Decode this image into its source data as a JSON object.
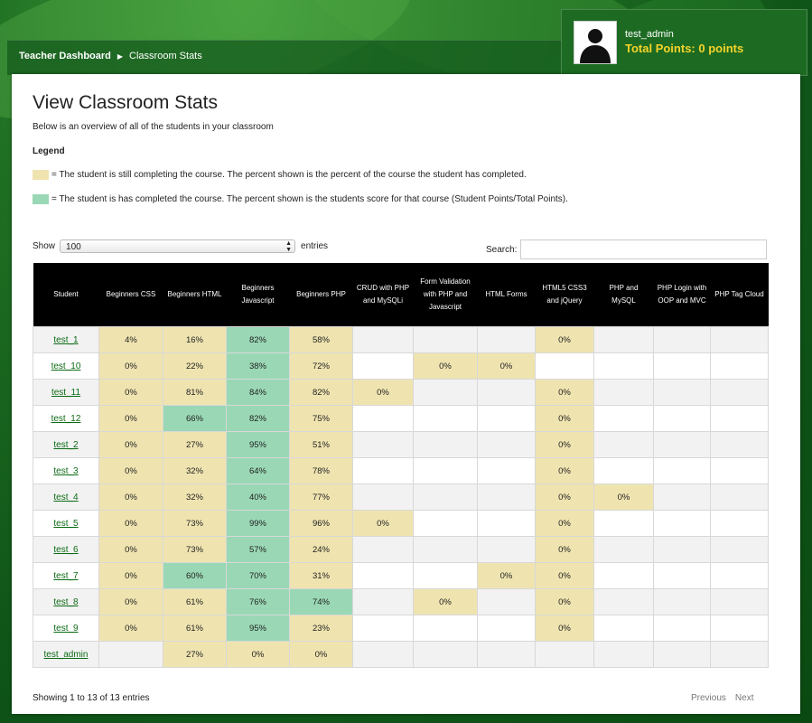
{
  "colors": {
    "in_progress": "#efe4b0",
    "completed": "#9ad8b5",
    "header_bg": "#000000",
    "accent": "#f5d32a"
  },
  "breadcrumb": {
    "root": "Teacher Dashboard",
    "current": "Classroom Stats"
  },
  "user": {
    "name": "test_admin",
    "points": "Total Points: 0 points",
    "avatar_icon": "user-silhouette-icon"
  },
  "page": {
    "title": "View Classroom Stats",
    "intro": "Below is an overview of all of the students in your classroom",
    "legend_title": "Legend",
    "legend_in_progress": "= The student is still completing the course. The percent shown is the percent of the course the student has completed.",
    "legend_completed": "= The student is has completed the course. The percent shown is the students score for that course (Student Points/Total Points)."
  },
  "controls": {
    "show_label": "Show",
    "show_value": "100",
    "entries_label": "entries",
    "search_label": "Search:",
    "search_value": ""
  },
  "table": {
    "columns": [
      "Student",
      "Beginners CSS",
      "Beginners HTML",
      "Beginners Javascript",
      "Beginners PHP",
      "CRUD with PHP and MySQLi",
      "Form Validation with PHP and Javascript",
      "HTML Forms",
      "HTML5 CSS3 and jQuery",
      "PHP and MySQL",
      "PHP Login with OOP and MVC",
      "PHP Tag Cloud"
    ],
    "rows": [
      {
        "student": "test_1",
        "cells": [
          {
            "v": "4%",
            "s": "p"
          },
          {
            "v": "16%",
            "s": "p"
          },
          {
            "v": "82%",
            "s": "c"
          },
          {
            "v": "58%",
            "s": "p"
          },
          {
            "v": "",
            "s": ""
          },
          {
            "v": "",
            "s": ""
          },
          {
            "v": "",
            "s": ""
          },
          {
            "v": "0%",
            "s": "p"
          },
          {
            "v": "",
            "s": ""
          },
          {
            "v": "",
            "s": ""
          },
          {
            "v": "",
            "s": ""
          }
        ]
      },
      {
        "student": "test_10",
        "cells": [
          {
            "v": "0%",
            "s": "p"
          },
          {
            "v": "22%",
            "s": "p"
          },
          {
            "v": "38%",
            "s": "c"
          },
          {
            "v": "72%",
            "s": "p"
          },
          {
            "v": "",
            "s": ""
          },
          {
            "v": "0%",
            "s": "p"
          },
          {
            "v": "0%",
            "s": "p"
          },
          {
            "v": "",
            "s": ""
          },
          {
            "v": "",
            "s": ""
          },
          {
            "v": "",
            "s": ""
          },
          {
            "v": "",
            "s": ""
          }
        ]
      },
      {
        "student": "test_11",
        "cells": [
          {
            "v": "0%",
            "s": "p"
          },
          {
            "v": "81%",
            "s": "p"
          },
          {
            "v": "84%",
            "s": "c"
          },
          {
            "v": "82%",
            "s": "p"
          },
          {
            "v": "0%",
            "s": "p"
          },
          {
            "v": "",
            "s": ""
          },
          {
            "v": "",
            "s": ""
          },
          {
            "v": "0%",
            "s": "p"
          },
          {
            "v": "",
            "s": ""
          },
          {
            "v": "",
            "s": ""
          },
          {
            "v": "",
            "s": ""
          }
        ]
      },
      {
        "student": "test_12",
        "cells": [
          {
            "v": "0%",
            "s": "p"
          },
          {
            "v": "66%",
            "s": "c"
          },
          {
            "v": "82%",
            "s": "c"
          },
          {
            "v": "75%",
            "s": "p"
          },
          {
            "v": "",
            "s": ""
          },
          {
            "v": "",
            "s": ""
          },
          {
            "v": "",
            "s": ""
          },
          {
            "v": "0%",
            "s": "p"
          },
          {
            "v": "",
            "s": ""
          },
          {
            "v": "",
            "s": ""
          },
          {
            "v": "",
            "s": ""
          }
        ]
      },
      {
        "student": "test_2",
        "cells": [
          {
            "v": "0%",
            "s": "p"
          },
          {
            "v": "27%",
            "s": "p"
          },
          {
            "v": "95%",
            "s": "c"
          },
          {
            "v": "51%",
            "s": "p"
          },
          {
            "v": "",
            "s": ""
          },
          {
            "v": "",
            "s": ""
          },
          {
            "v": "",
            "s": ""
          },
          {
            "v": "0%",
            "s": "p"
          },
          {
            "v": "",
            "s": ""
          },
          {
            "v": "",
            "s": ""
          },
          {
            "v": "",
            "s": ""
          }
        ]
      },
      {
        "student": "test_3",
        "cells": [
          {
            "v": "0%",
            "s": "p"
          },
          {
            "v": "32%",
            "s": "p"
          },
          {
            "v": "64%",
            "s": "c"
          },
          {
            "v": "78%",
            "s": "p"
          },
          {
            "v": "",
            "s": ""
          },
          {
            "v": "",
            "s": ""
          },
          {
            "v": "",
            "s": ""
          },
          {
            "v": "0%",
            "s": "p"
          },
          {
            "v": "",
            "s": ""
          },
          {
            "v": "",
            "s": ""
          },
          {
            "v": "",
            "s": ""
          }
        ]
      },
      {
        "student": "test_4",
        "cells": [
          {
            "v": "0%",
            "s": "p"
          },
          {
            "v": "32%",
            "s": "p"
          },
          {
            "v": "40%",
            "s": "c"
          },
          {
            "v": "77%",
            "s": "p"
          },
          {
            "v": "",
            "s": ""
          },
          {
            "v": "",
            "s": ""
          },
          {
            "v": "",
            "s": ""
          },
          {
            "v": "0%",
            "s": "p"
          },
          {
            "v": "0%",
            "s": "p"
          },
          {
            "v": "",
            "s": ""
          },
          {
            "v": "",
            "s": ""
          }
        ]
      },
      {
        "student": "test_5",
        "cells": [
          {
            "v": "0%",
            "s": "p"
          },
          {
            "v": "73%",
            "s": "p"
          },
          {
            "v": "99%",
            "s": "c"
          },
          {
            "v": "96%",
            "s": "p"
          },
          {
            "v": "0%",
            "s": "p"
          },
          {
            "v": "",
            "s": ""
          },
          {
            "v": "",
            "s": ""
          },
          {
            "v": "0%",
            "s": "p"
          },
          {
            "v": "",
            "s": ""
          },
          {
            "v": "",
            "s": ""
          },
          {
            "v": "",
            "s": ""
          }
        ]
      },
      {
        "student": "test_6",
        "cells": [
          {
            "v": "0%",
            "s": "p"
          },
          {
            "v": "73%",
            "s": "p"
          },
          {
            "v": "57%",
            "s": "c"
          },
          {
            "v": "24%",
            "s": "p"
          },
          {
            "v": "",
            "s": ""
          },
          {
            "v": "",
            "s": ""
          },
          {
            "v": "",
            "s": ""
          },
          {
            "v": "0%",
            "s": "p"
          },
          {
            "v": "",
            "s": ""
          },
          {
            "v": "",
            "s": ""
          },
          {
            "v": "",
            "s": ""
          }
        ]
      },
      {
        "student": "test_7",
        "cells": [
          {
            "v": "0%",
            "s": "p"
          },
          {
            "v": "60%",
            "s": "c"
          },
          {
            "v": "70%",
            "s": "c"
          },
          {
            "v": "31%",
            "s": "p"
          },
          {
            "v": "",
            "s": ""
          },
          {
            "v": "",
            "s": ""
          },
          {
            "v": "0%",
            "s": "p"
          },
          {
            "v": "0%",
            "s": "p"
          },
          {
            "v": "",
            "s": ""
          },
          {
            "v": "",
            "s": ""
          },
          {
            "v": "",
            "s": ""
          }
        ]
      },
      {
        "student": "test_8",
        "cells": [
          {
            "v": "0%",
            "s": "p"
          },
          {
            "v": "61%",
            "s": "p"
          },
          {
            "v": "76%",
            "s": "c"
          },
          {
            "v": "74%",
            "s": "c"
          },
          {
            "v": "",
            "s": ""
          },
          {
            "v": "0%",
            "s": "p"
          },
          {
            "v": "",
            "s": ""
          },
          {
            "v": "0%",
            "s": "p"
          },
          {
            "v": "",
            "s": ""
          },
          {
            "v": "",
            "s": ""
          },
          {
            "v": "",
            "s": ""
          }
        ]
      },
      {
        "student": "test_9",
        "cells": [
          {
            "v": "0%",
            "s": "p"
          },
          {
            "v": "61%",
            "s": "p"
          },
          {
            "v": "95%",
            "s": "c"
          },
          {
            "v": "23%",
            "s": "p"
          },
          {
            "v": "",
            "s": ""
          },
          {
            "v": "",
            "s": ""
          },
          {
            "v": "",
            "s": ""
          },
          {
            "v": "0%",
            "s": "p"
          },
          {
            "v": "",
            "s": ""
          },
          {
            "v": "",
            "s": ""
          },
          {
            "v": "",
            "s": ""
          }
        ]
      },
      {
        "student": "test_admin",
        "cells": [
          {
            "v": "",
            "s": ""
          },
          {
            "v": "27%",
            "s": "p"
          },
          {
            "v": "0%",
            "s": "p"
          },
          {
            "v": "0%",
            "s": "p"
          },
          {
            "v": "",
            "s": ""
          },
          {
            "v": "",
            "s": ""
          },
          {
            "v": "",
            "s": ""
          },
          {
            "v": "",
            "s": ""
          },
          {
            "v": "",
            "s": ""
          },
          {
            "v": "",
            "s": ""
          },
          {
            "v": "",
            "s": ""
          }
        ]
      }
    ]
  },
  "footer": {
    "info": "Showing 1 to 13 of 13 entries",
    "previous": "Previous",
    "next": "Next"
  }
}
